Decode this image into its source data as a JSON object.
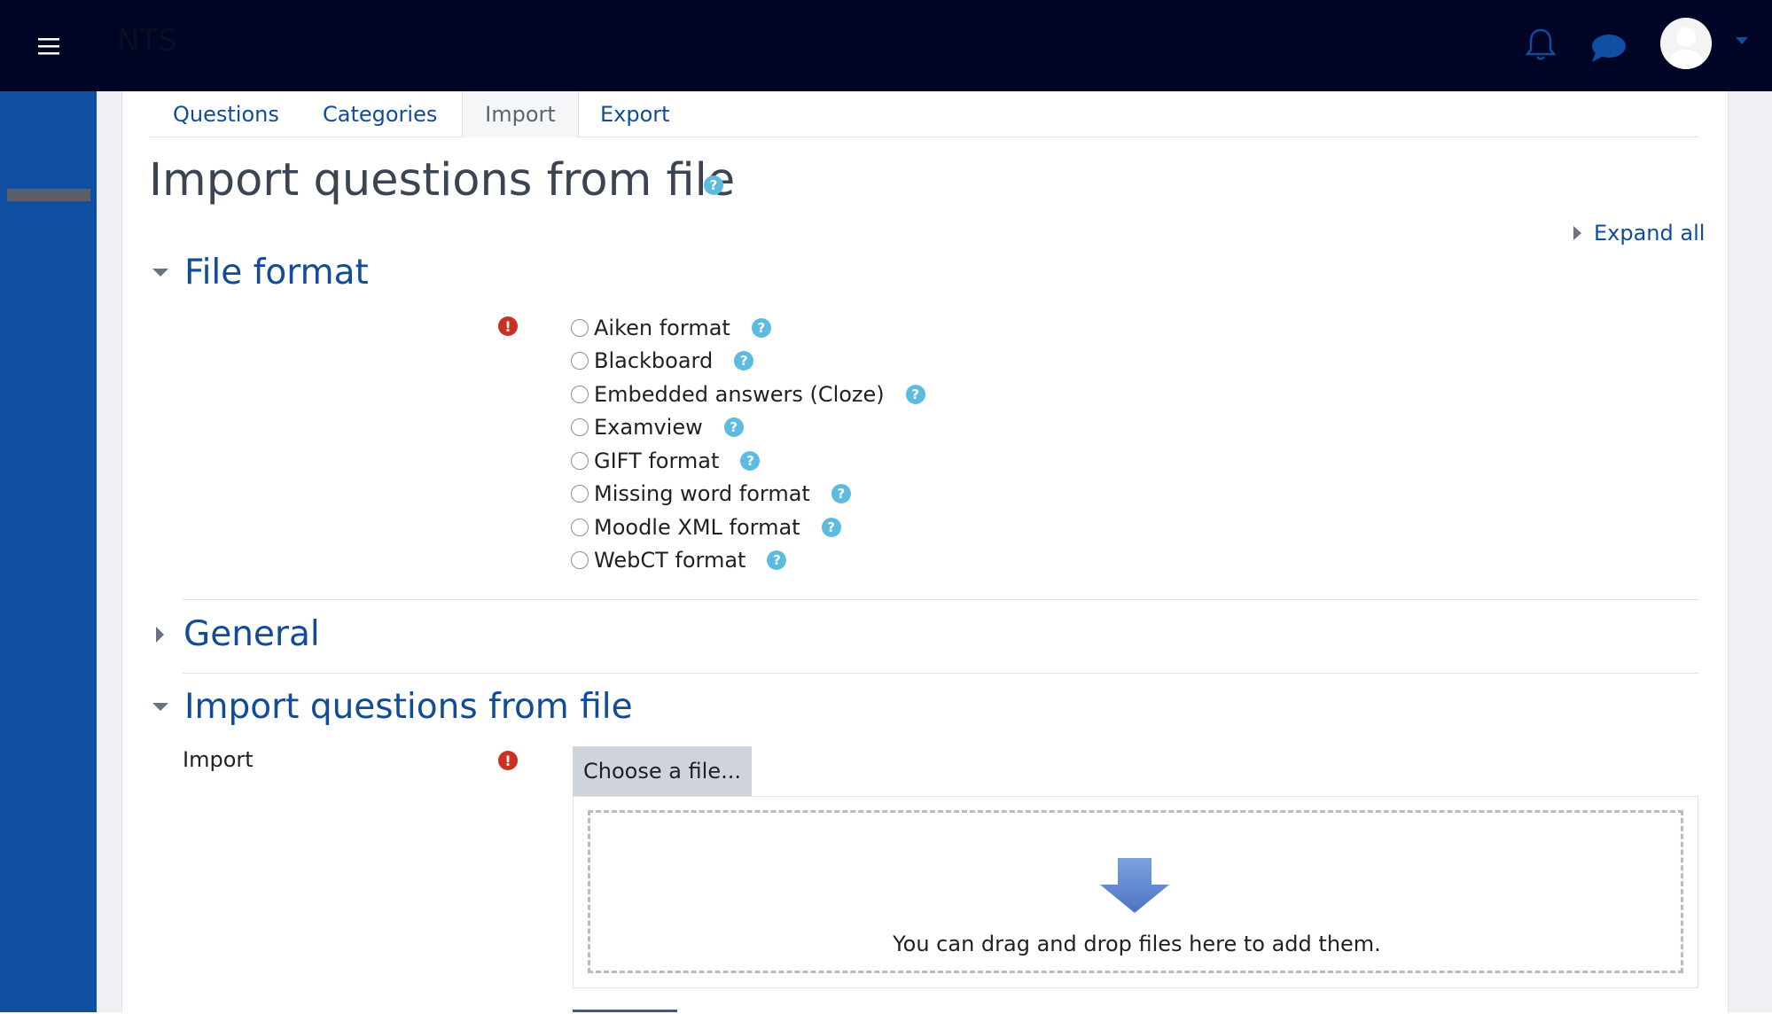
{
  "navbar": {
    "site_name": "NTS",
    "menu_icon": "hamburger-icon",
    "notification_icon": "bell-icon",
    "messages_icon": "chat-bubble-icon",
    "user_icon": "avatar-icon"
  },
  "tabs": [
    {
      "label": "Questions"
    },
    {
      "label": "Categories"
    },
    {
      "label": "Import",
      "active": true
    },
    {
      "label": "Export"
    }
  ],
  "page": {
    "title": "Import questions from file",
    "expand_all": "Expand all"
  },
  "sections": {
    "file_format": {
      "title": "File format",
      "options": [
        {
          "label": "Aiken format"
        },
        {
          "label": "Blackboard"
        },
        {
          "label": "Embedded answers (Cloze)"
        },
        {
          "label": "Examview"
        },
        {
          "label": "GIFT format"
        },
        {
          "label": "Missing word format"
        },
        {
          "label": "Moodle XML format"
        },
        {
          "label": "WebCT format"
        }
      ]
    },
    "general": {
      "title": "General"
    },
    "import_file": {
      "title": "Import questions from file",
      "field_label": "Import",
      "choose_button": "Choose a file...",
      "drop_text": "You can drag and drop files here to add them."
    }
  },
  "colors": {
    "navbar": "#000525",
    "drawer": "#0f4ea0",
    "link": "#114c9a",
    "required": "#ca3120",
    "help": "#5bbcdf"
  }
}
